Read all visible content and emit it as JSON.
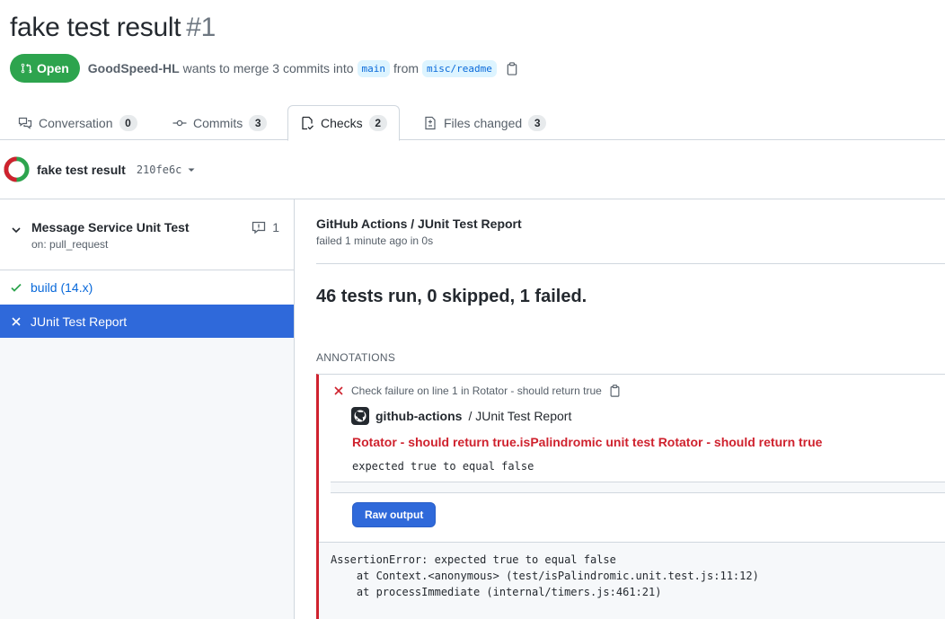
{
  "pr": {
    "title": "fake test result",
    "number": "#1",
    "state": "Open",
    "author": "GoodSpeed-HL",
    "merge_text": "wants to merge 3 commits into",
    "base_branch": "main",
    "from_text": "from",
    "head_branch": "misc/readme"
  },
  "tabs": [
    {
      "label": "Conversation",
      "count": "0",
      "icon": "comment-discussion-icon"
    },
    {
      "label": "Commits",
      "count": "3",
      "icon": "git-commit-icon"
    },
    {
      "label": "Checks",
      "count": "2",
      "icon": "checklist-icon",
      "selected": true
    },
    {
      "label": "Files changed",
      "count": "3",
      "icon": "file-diff-icon"
    }
  ],
  "checks_header": {
    "title": "fake test result",
    "sha": "210fe6c"
  },
  "sidebar": {
    "workflow": {
      "name": "Message Service Unit Test",
      "event": "on: pull_request",
      "annotations_count": "1"
    },
    "jobs": [
      {
        "label": "build (14.x)",
        "status": "success"
      },
      {
        "label": "JUnit Test Report",
        "status": "failure",
        "selected": true
      }
    ]
  },
  "main": {
    "run_title": "GitHub Actions / JUnit Test Report",
    "run_status": "failed 1 minute ago in 0s",
    "summary": "46 tests run, 0 skipped, 1 failed.",
    "annotations_heading": "ANNOTATIONS",
    "annotation": {
      "header": "Check failure on line 1 in Rotator - should return true",
      "app_name": "github-actions",
      "app_suffix": "/ JUnit Test Report",
      "title": "Rotator - should return true.isPalindromic unit test Rotator - should return true",
      "message": "expected true to equal false",
      "raw_button": "Raw output",
      "raw_output": [
        "AssertionError: expected true to equal false",
        "    at Context.<anonymous> (test/isPalindromic.unit.test.js:11:12)",
        "    at processImmediate (internal/timers.js:461:21)"
      ]
    }
  },
  "colors": {
    "open_green": "#2da44e",
    "failure_red": "#cf222e",
    "link_blue": "#0969da",
    "selected_job_bg": "#2f69da"
  }
}
